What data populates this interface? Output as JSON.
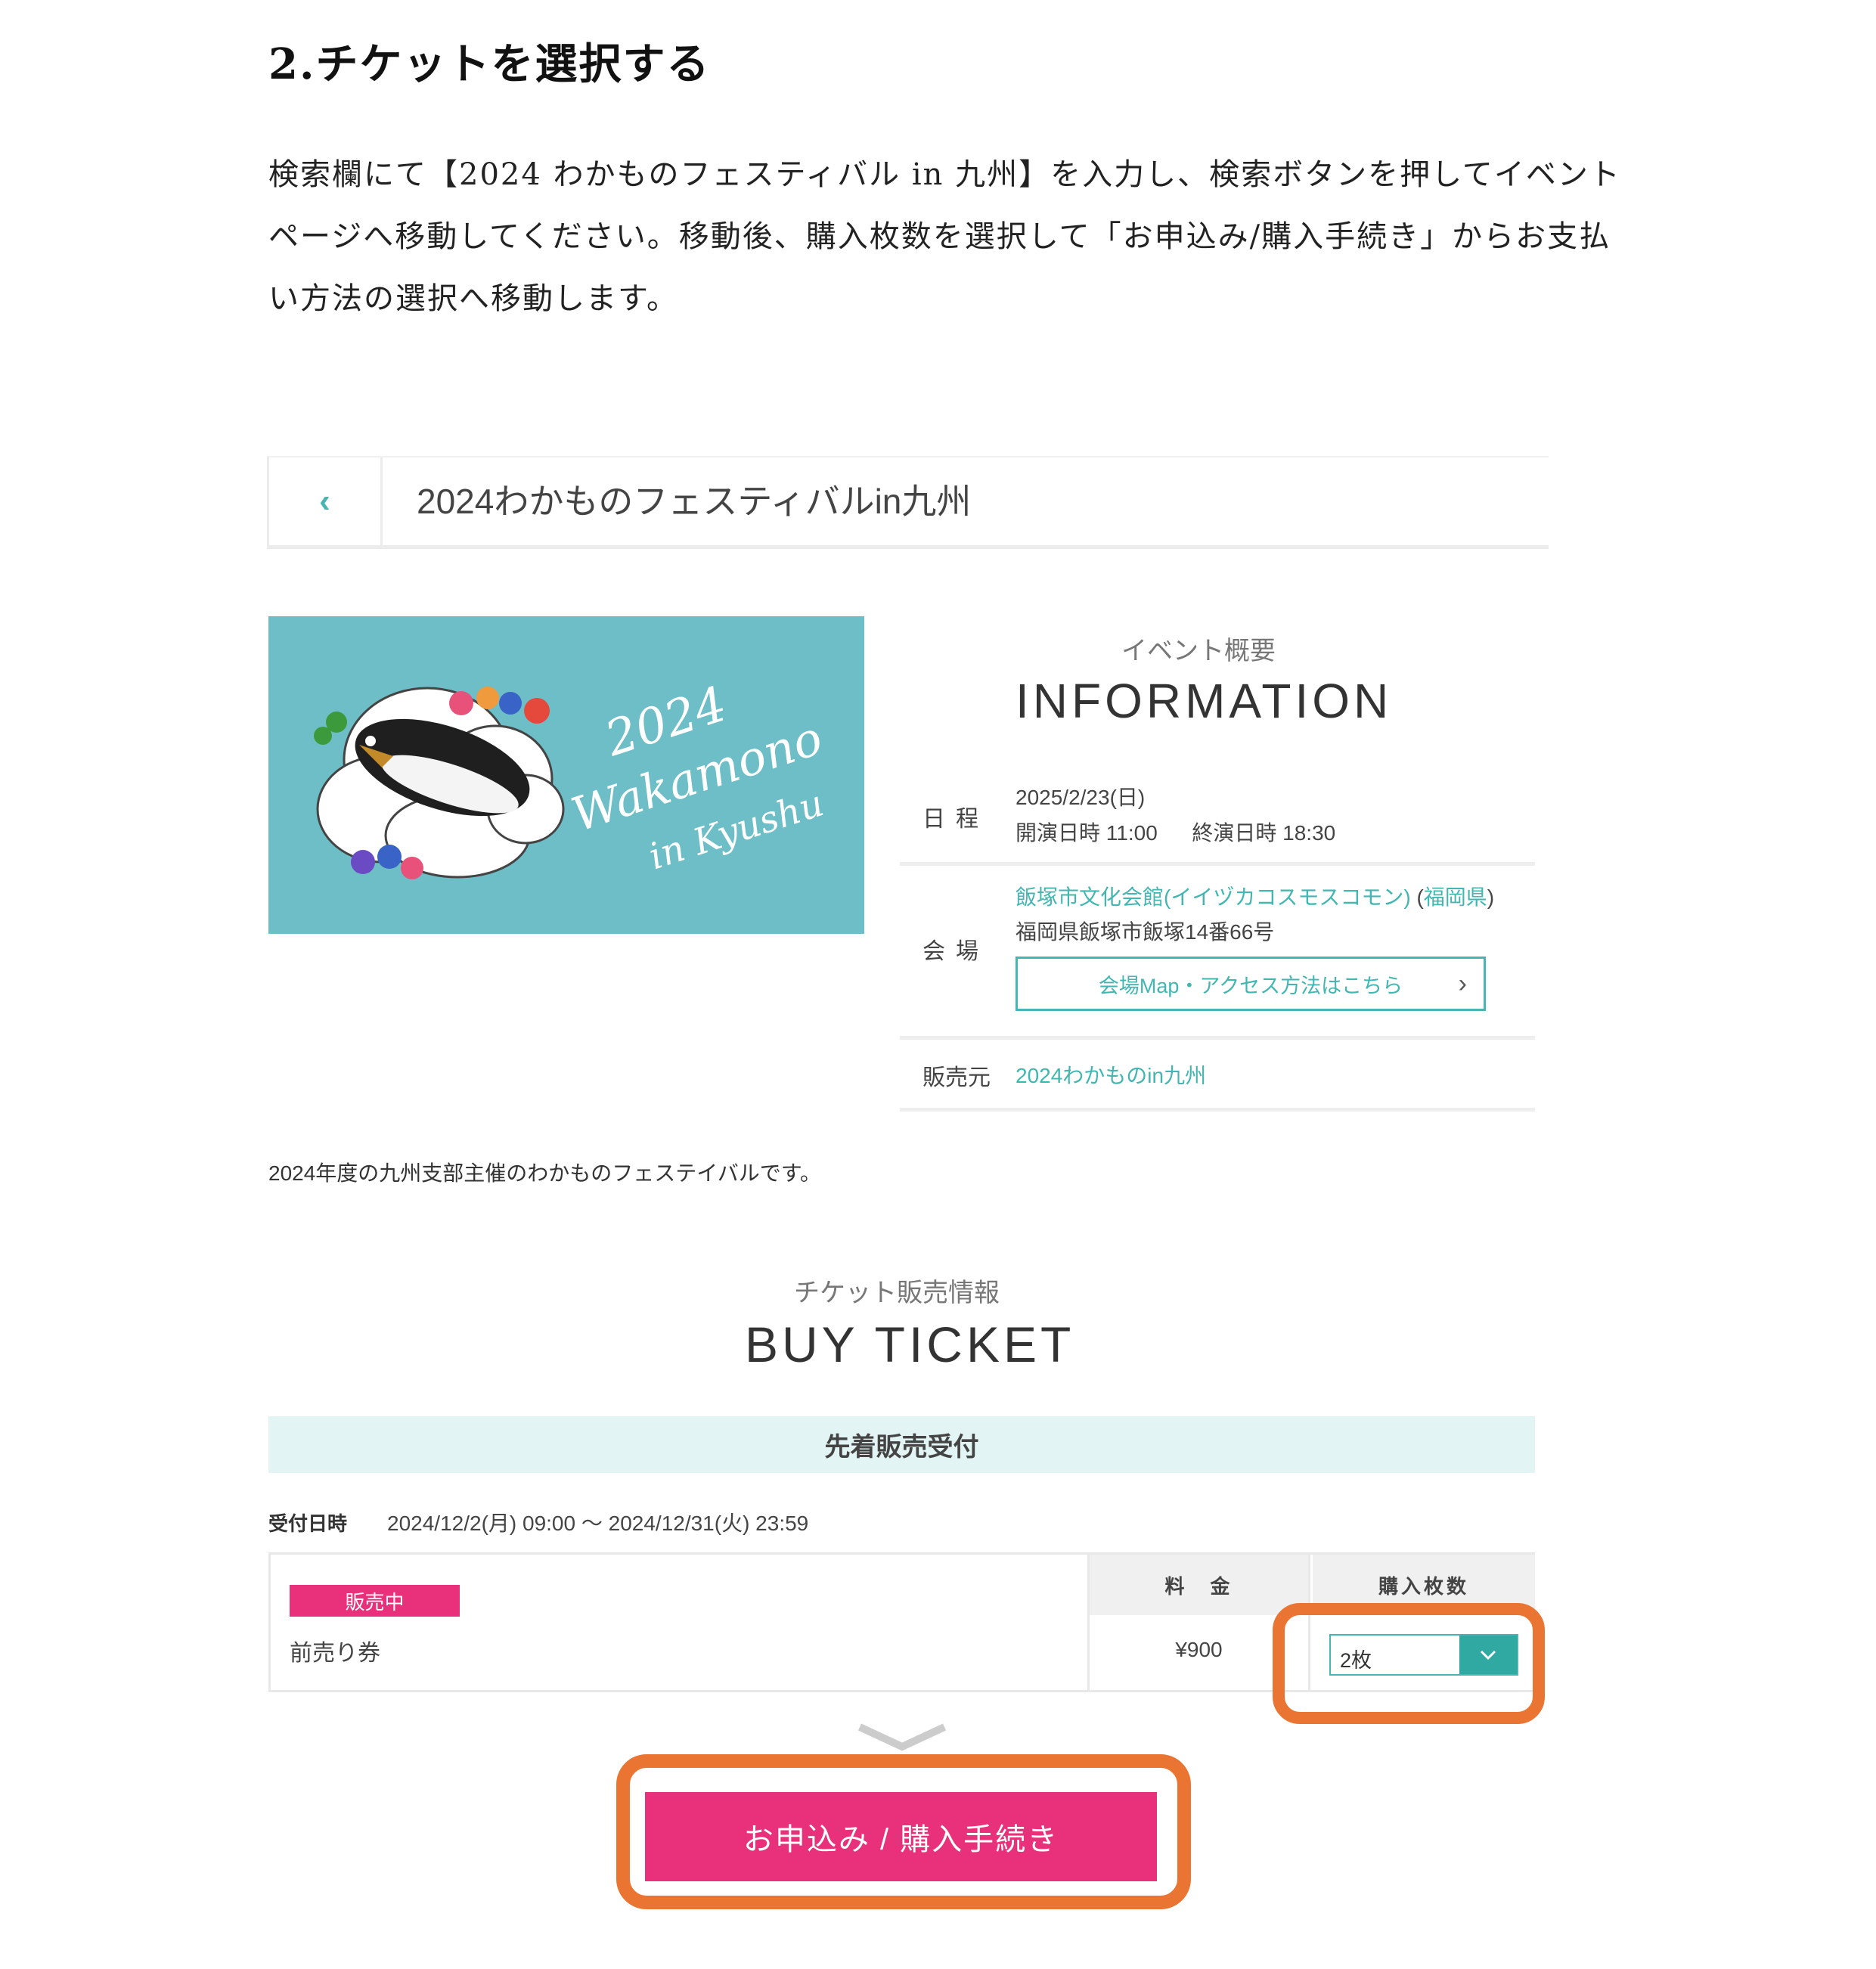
{
  "article": {
    "step_title": "2.チケットを選択する",
    "instructions": "検索欄にて【2024 わかものフェスティバル in 九州】を入力し、検索ボタンを押してイベントページへ移動してください。移動後、購入枚数を選択して「お申込み/購入手続き」からお支払い方法の選択へ移動します。"
  },
  "header": {
    "back_icon": "chevron-left-icon",
    "back_glyph": "‹",
    "title": "2024わかものフェスティバルin九州"
  },
  "banner": {
    "text_line1": "2024",
    "text_line2": "Wakamono",
    "text_line3": "in Kyushu",
    "background": "#6dbec6"
  },
  "information": {
    "subtitle": "イベント概要",
    "title": "INFORMATION",
    "schedule": {
      "label": "日程",
      "date": "2025/2/23(日)",
      "open_label": "開演日時",
      "open_time": "11:00",
      "close_label": "終演日時",
      "close_time": "18:30"
    },
    "venue": {
      "label": "会場",
      "name": "飯塚市文化会館(イイヅカコスモスコモン)",
      "prefecture": "福岡県",
      "address": "福岡県飯塚市飯塚14番66号",
      "map_button": "会場Map・アクセス方法はこちら",
      "map_chevron": "›"
    },
    "seller": {
      "label": "販売元",
      "name": "2024わかものin九州"
    }
  },
  "description": "2024年度の九州支部主催のわかものフェステイバルです。",
  "buy_ticket": {
    "subtitle": "チケット販売情報",
    "title": "BUY TICKET",
    "sales_type": "先着販売受付",
    "period_label": "受付日時",
    "period": "2024/12/2(月) 09:00 ～ 2024/12/31(火) 23:59",
    "table": {
      "price_header": "料　金",
      "qty_header": "購入枚数",
      "rows": [
        {
          "status": "販売中",
          "name": "前売り券",
          "price": "¥900",
          "quantity": "2枚"
        }
      ]
    },
    "qty_arrow": "⌄",
    "apply_button": "お申込み / 購入手続き"
  },
  "colors": {
    "teal": "#42b6b0",
    "pink": "#e8317a",
    "highlight": "#ea7532",
    "band": "#e2f4f3"
  }
}
